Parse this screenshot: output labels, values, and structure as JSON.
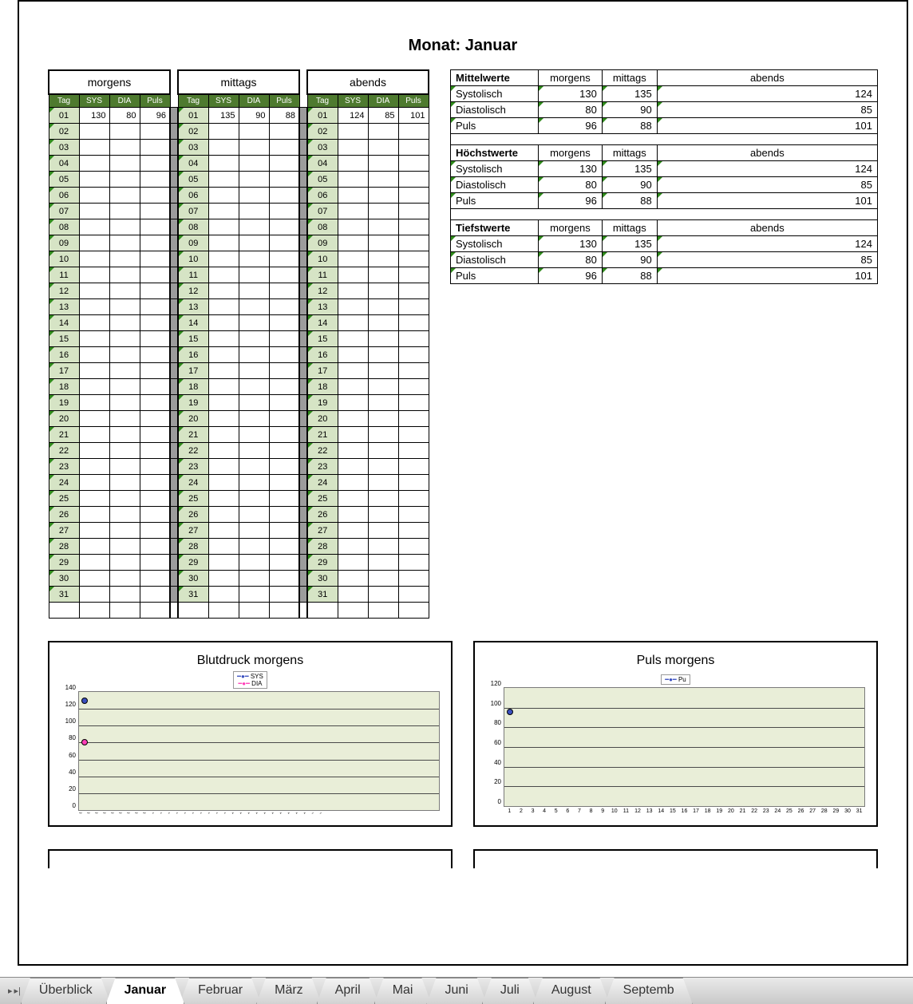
{
  "title": "Monat: Januar",
  "periods": [
    "morgens",
    "mittags",
    "abends"
  ],
  "col_headers": [
    "Tag",
    "SYS",
    "DIA",
    "Puls"
  ],
  "days": [
    "01",
    "02",
    "03",
    "04",
    "05",
    "06",
    "07",
    "08",
    "09",
    "10",
    "11",
    "12",
    "13",
    "14",
    "15",
    "16",
    "17",
    "18",
    "19",
    "20",
    "21",
    "22",
    "23",
    "24",
    "25",
    "26",
    "27",
    "28",
    "29",
    "30",
    "31"
  ],
  "entries": {
    "morgens": {
      "01": {
        "sys": 130,
        "dia": 80,
        "puls": 96
      }
    },
    "mittags": {
      "01": {
        "sys": 135,
        "dia": 90,
        "puls": 88
      }
    },
    "abends": {
      "01": {
        "sys": 124,
        "dia": 85,
        "puls": 101
      }
    }
  },
  "stats": [
    {
      "heading": "Mittelwerte",
      "rows": [
        {
          "label": "Systolisch",
          "morgens": 130,
          "mittags": 135,
          "abends": 124
        },
        {
          "label": "Diastolisch",
          "morgens": 80,
          "mittags": 90,
          "abends": 85
        },
        {
          "label": "Puls",
          "morgens": 96,
          "mittags": 88,
          "abends": 101
        }
      ]
    },
    {
      "heading": "Höchstwerte",
      "rows": [
        {
          "label": "Systolisch",
          "morgens": 130,
          "mittags": 135,
          "abends": 124
        },
        {
          "label": "Diastolisch",
          "morgens": 80,
          "mittags": 90,
          "abends": 85
        },
        {
          "label": "Puls",
          "morgens": 96,
          "mittags": 88,
          "abends": 101
        }
      ]
    },
    {
      "heading": "Tiefstwerte",
      "rows": [
        {
          "label": "Systolisch",
          "morgens": 130,
          "mittags": 135,
          "abends": 124
        },
        {
          "label": "Diastolisch",
          "morgens": 80,
          "mittags": 90,
          "abends": 85
        },
        {
          "label": "Puls",
          "morgens": 96,
          "mittags": 88,
          "abends": 101
        }
      ]
    }
  ],
  "chart1": {
    "title": "Blutdruck morgens",
    "legend": [
      "SYS",
      "DIA"
    ]
  },
  "chart2": {
    "title": "Puls morgens",
    "legend": [
      "Pu"
    ]
  },
  "chart_data": [
    {
      "type": "line",
      "title": "Blutdruck morgens",
      "series": [
        {
          "name": "SYS",
          "x": [
            "01.01.00"
          ],
          "values": [
            130
          ],
          "color": "#3a4fbf"
        },
        {
          "name": "DIA",
          "x": [
            "01.01.00"
          ],
          "values": [
            80
          ],
          "color": "#ff3fb8"
        }
      ],
      "categories": [
        "01.01.00",
        "02.01.00",
        "03.01.00",
        "04.01.00",
        "05.01.00",
        "06.01.00",
        "07.01.00",
        "08.01.00",
        "09.01.00",
        "10.01.00",
        "11.01.00",
        "12.01.00",
        "13.01.00",
        "14.01.00",
        "15.01.00",
        "16.01.00",
        "17.01.00",
        "18.01.00",
        "19.01.00",
        "20.01.00",
        "21.01.00",
        "22.01.00",
        "23.01.00",
        "24.01.00",
        "25.01.00",
        "26.01.00",
        "27.01.00",
        "28.01.00",
        "29.01.00",
        "30.01.00",
        "31.01.00"
      ],
      "ylim": [
        0,
        140
      ],
      "yticks": [
        0,
        20,
        40,
        60,
        80,
        100,
        120,
        140
      ]
    },
    {
      "type": "line",
      "title": "Puls morgens",
      "series": [
        {
          "name": "Pu",
          "x": [
            1
          ],
          "values": [
            96
          ],
          "color": "#3a4fbf"
        }
      ],
      "categories": [
        1,
        2,
        3,
        4,
        5,
        6,
        7,
        8,
        9,
        10,
        11,
        12,
        13,
        14,
        15,
        16,
        17,
        18,
        19,
        20,
        21,
        22,
        23,
        24,
        25,
        26,
        27,
        28,
        29,
        30,
        31
      ],
      "ylim": [
        0,
        120
      ],
      "yticks": [
        0,
        20,
        40,
        60,
        80,
        100,
        120
      ]
    }
  ],
  "tabs": [
    "Überblick",
    "Januar",
    "Februar",
    "März",
    "April",
    "Mai",
    "Juni",
    "Juli",
    "August",
    "Septemb"
  ],
  "active_tab": "Januar"
}
